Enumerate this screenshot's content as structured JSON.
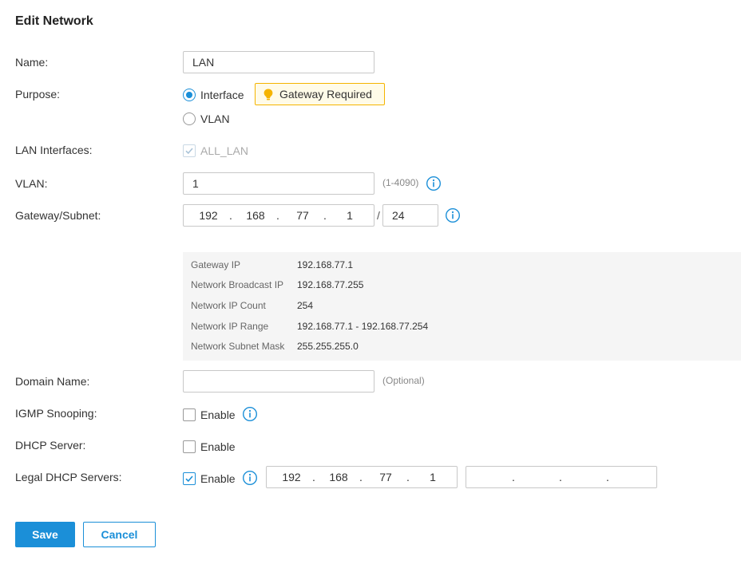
{
  "title": "Edit Network",
  "fields": {
    "name": {
      "label": "Name:",
      "value": "LAN"
    },
    "purpose": {
      "label": "Purpose:",
      "options": [
        "Interface",
        "VLAN"
      ],
      "selected": "Interface",
      "badge": "Gateway Required"
    },
    "lan_interfaces": {
      "label": "LAN Interfaces:",
      "option": "ALL_LAN",
      "checked": true,
      "disabled": true
    },
    "vlan": {
      "label": "VLAN:",
      "value": "1",
      "hint": "(1-4090)"
    },
    "gateway_subnet": {
      "label": "Gateway/Subnet:",
      "octets": [
        "192",
        "168",
        "77",
        "1"
      ],
      "separator": "/",
      "mask": "24"
    },
    "domain_name": {
      "label": "Domain Name:",
      "value": "",
      "hint": "(Optional)"
    },
    "igmp_snooping": {
      "label": "IGMP Snooping:",
      "option": "Enable",
      "checked": false
    },
    "dhcp_server": {
      "label": "DHCP Server:",
      "option": "Enable",
      "checked": false
    },
    "legal_dhcp": {
      "label": "Legal DHCP Servers:",
      "option": "Enable",
      "checked": true,
      "ip1": [
        "192",
        "168",
        "77",
        "1"
      ],
      "ip2": [
        "",
        "",
        "",
        ""
      ]
    }
  },
  "network_info": [
    {
      "label": "Gateway IP",
      "value": "192.168.77.1"
    },
    {
      "label": "Network Broadcast IP",
      "value": "192.168.77.255"
    },
    {
      "label": "Network IP Count",
      "value": "254"
    },
    {
      "label": "Network IP Range",
      "value": "192.168.77.1 - 192.168.77.254"
    },
    {
      "label": "Network Subnet Mask",
      "value": "255.255.255.0"
    }
  ],
  "buttons": {
    "save": "Save",
    "cancel": "Cancel"
  },
  "colors": {
    "accent": "#1b8fd8",
    "badge_border": "#f5b400",
    "badge_icon": "#f5b400"
  }
}
